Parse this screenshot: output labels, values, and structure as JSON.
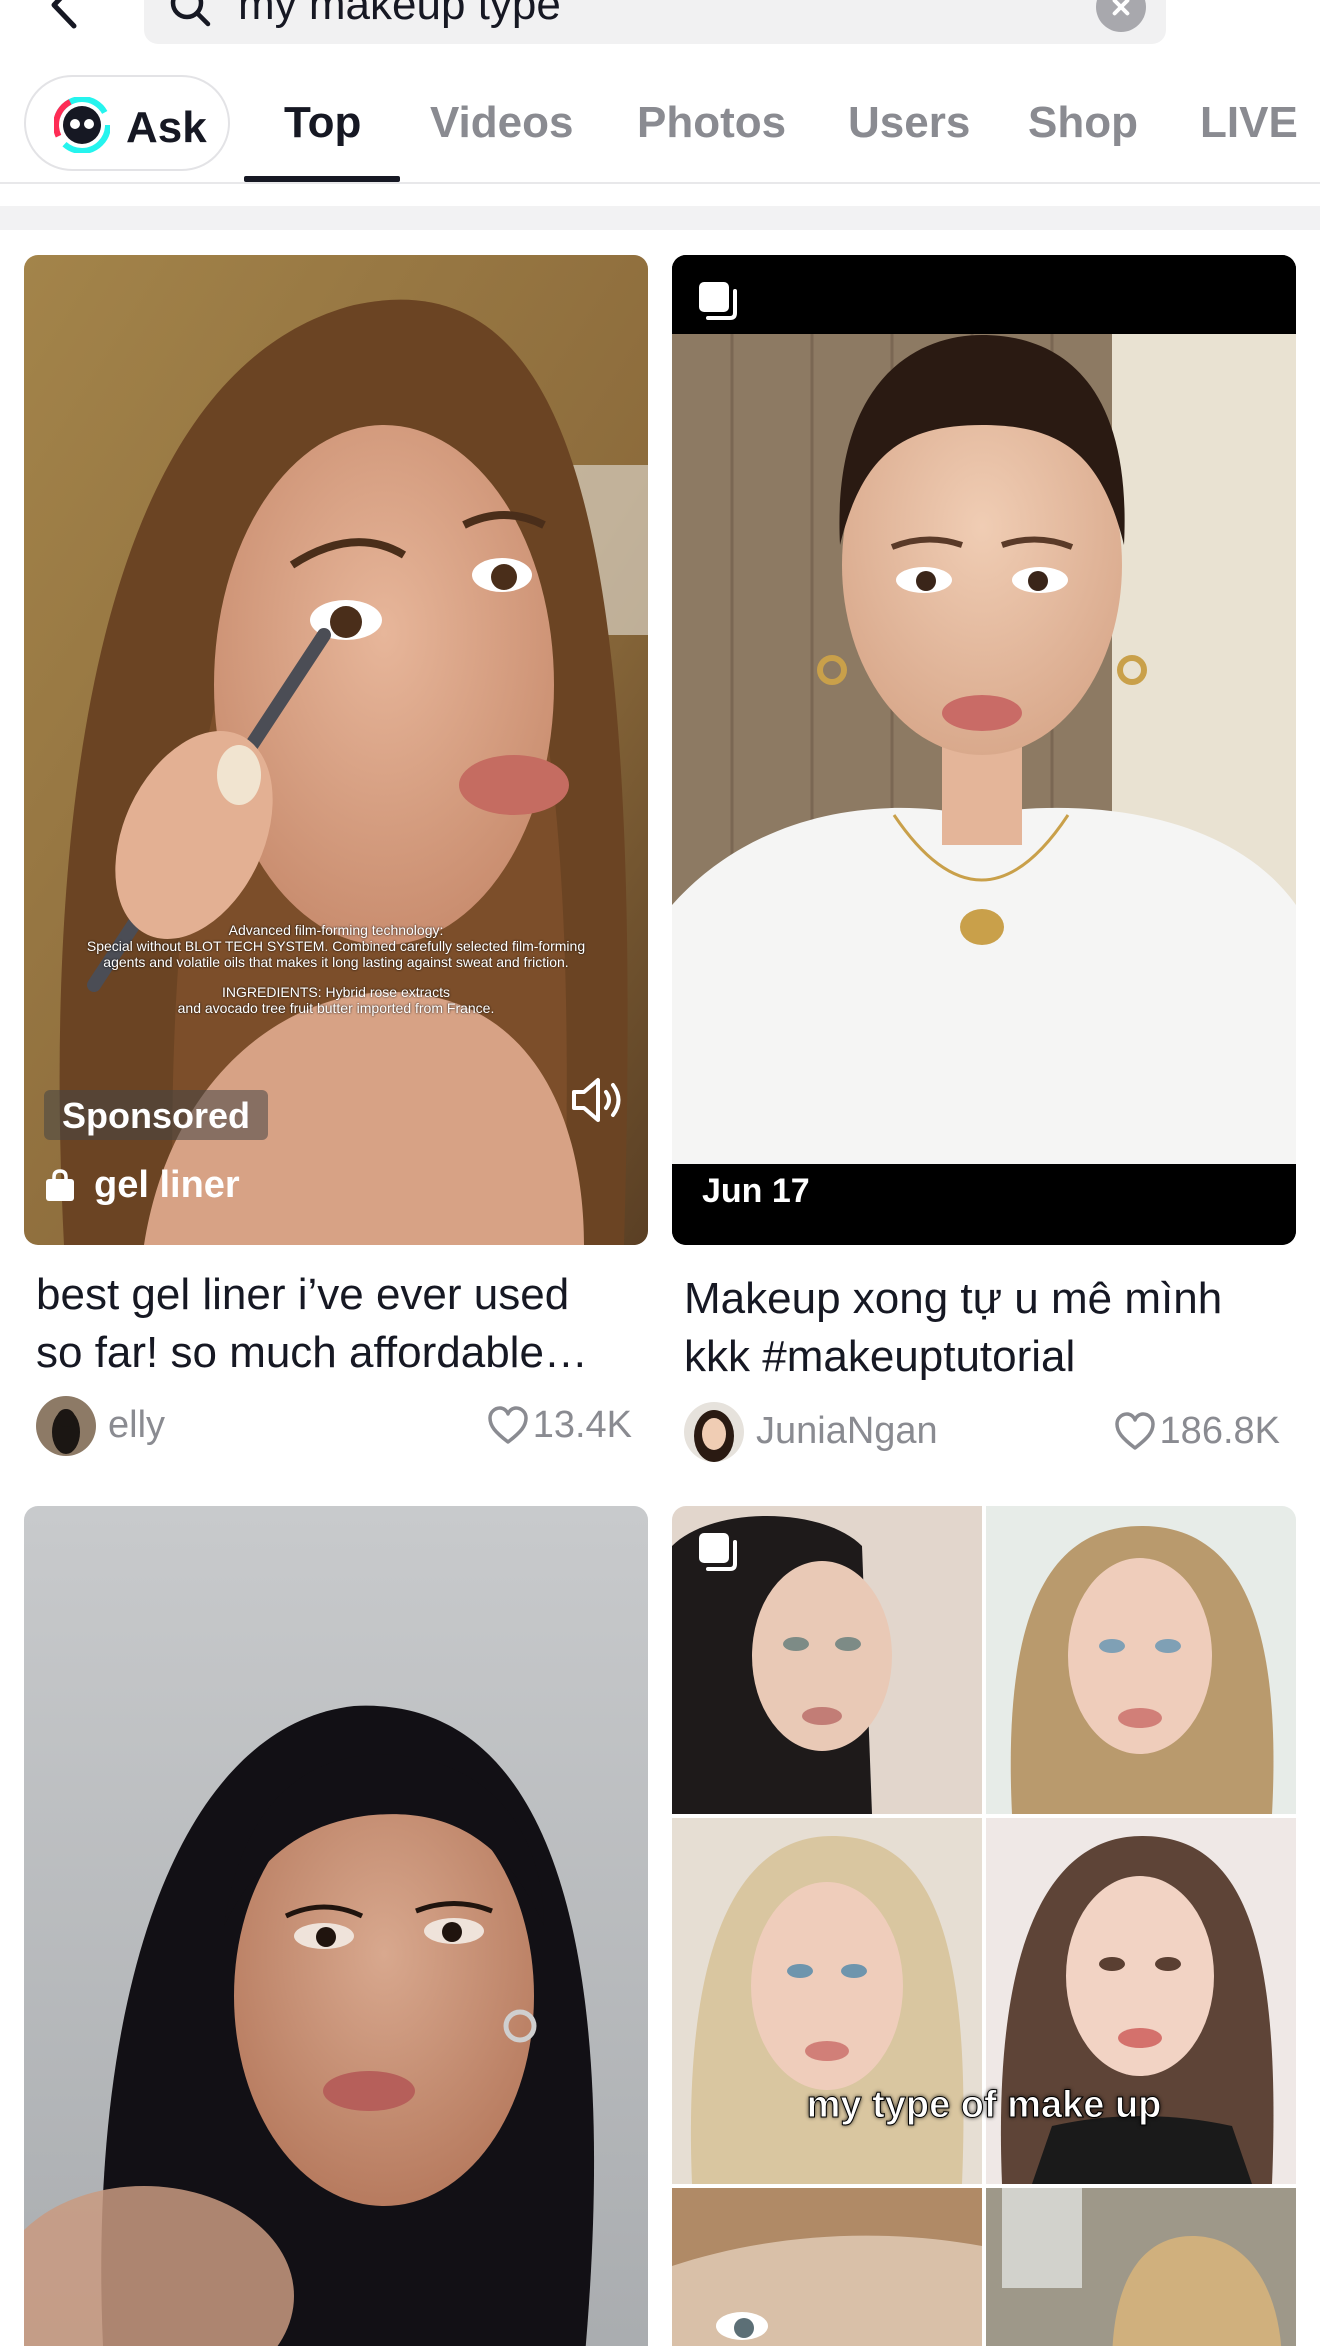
{
  "search": {
    "query": "my makeup type",
    "back_icon": "chevron-left-icon",
    "search_icon": "magnifier-icon",
    "clear_icon": "clear-circle-icon"
  },
  "tabs": {
    "ask_label": "Ask",
    "items": [
      {
        "label": "Top",
        "active": true
      },
      {
        "label": "Videos",
        "active": false
      },
      {
        "label": "Photos",
        "active": false
      },
      {
        "label": "Users",
        "active": false
      },
      {
        "label": "Shop",
        "active": false
      },
      {
        "label": "LIVE",
        "active": false
      }
    ]
  },
  "colors": {
    "text_primary": "#161823",
    "text_secondary": "#8a8b91",
    "search_bg": "#f1f1f2",
    "ask_logo_pink": "#fe2c55",
    "ask_logo_cyan": "#25f4ee"
  },
  "cards": [
    {
      "type": "video",
      "badge": "Sponsored",
      "shop_tag": "gel liner",
      "overlay_text": [
        "Advanced film-forming technology:",
        "Special without BLOT TECH SYSTEM. Combined carefully selected film-forming",
        "agents and volatile oils that makes it long lasting against sweat and friction.",
        "INGREDIENTS: Hybrid rose extracts",
        "and avocado tree fruit butter imported from France."
      ],
      "caption_line1": "best gel liner i’ve ever used",
      "caption_line2": "so far! so much affordable…",
      "author": "elly",
      "likes": "13.4K"
    },
    {
      "type": "photo",
      "date": "Jun 17",
      "caption_line1": "Makeup xong tự u mê mình",
      "caption_line2": "kkk #makeuptutorial",
      "author": "JuniaNgan",
      "likes": "186.8K"
    },
    {
      "type": "video"
    },
    {
      "type": "photo",
      "overlay_caption": "my type of make up"
    }
  ]
}
